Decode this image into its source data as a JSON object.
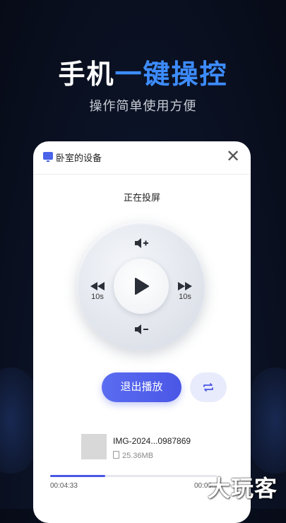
{
  "hero": {
    "title_part1": "手机",
    "title_part2": "一键操控",
    "subtitle": "操作简单使用方便"
  },
  "device": {
    "icon": "tv-icon",
    "name": "卧室的设备",
    "close_icon": "close-icon"
  },
  "player": {
    "status": "正在投屏",
    "rewind_label": "10s",
    "forward_label": "10s",
    "exit_label": "退出播放",
    "loop_icon": "loop-icon"
  },
  "media": {
    "file_name": "IMG-2024...0987869",
    "file_size": "25.36MB",
    "current_time": "00:04:33",
    "total_time": "00:09:...",
    "progress": 0.33
  },
  "watermark": "大玩客",
  "colors": {
    "accent": "#3d8cff",
    "button": "#4a57e6"
  }
}
